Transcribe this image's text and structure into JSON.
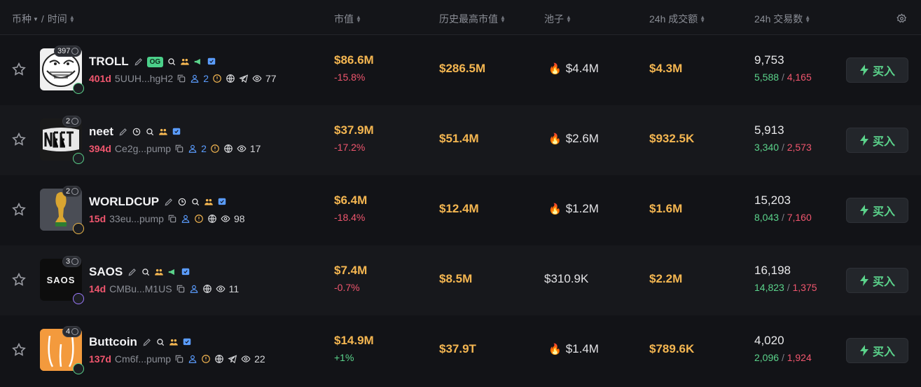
{
  "header": {
    "coin_label": "币种",
    "separator": "/",
    "time_label": "时间",
    "market_cap": "市值",
    "ath_market_cap": "历史最高市值",
    "pool": "池子",
    "volume_24h": "24h 成交额",
    "txns_24h": "24h 交易数"
  },
  "buy_label": "买入",
  "rows": [
    {
      "name": "TROLL",
      "og": "OG",
      "watchers": "397",
      "age": "401d",
      "address": "5UUH...hgH2",
      "holders": "2",
      "views": "77",
      "market_cap": "$86.6M",
      "change": "-15.8%",
      "ath": "$286.5M",
      "pool": "$4.4M",
      "pool_hot": true,
      "volume": "$4.3M",
      "txns": "9,753",
      "buys": "5,588",
      "slash": "/",
      "sells": "4,165"
    },
    {
      "name": "neet",
      "watchers": "2",
      "age": "394d",
      "address": "Ce2g...pump",
      "holders": "2",
      "views": "17",
      "market_cap": "$37.9M",
      "change": "-17.2%",
      "ath": "$51.4M",
      "pool": "$2.6M",
      "pool_hot": true,
      "volume": "$932.5K",
      "txns": "5,913",
      "buys": "3,340",
      "slash": "/",
      "sells": "2,573"
    },
    {
      "name": "WORLDCUP",
      "watchers": "2",
      "age": "15d",
      "address": "33eu...pump",
      "views": "98",
      "market_cap": "$6.4M",
      "change": "-18.4%",
      "ath": "$12.4M",
      "pool": "$1.2M",
      "pool_hot": true,
      "volume": "$1.6M",
      "txns": "15,203",
      "buys": "8,043",
      "slash": "/",
      "sells": "7,160"
    },
    {
      "name": "SAOS",
      "watchers": "3",
      "avatar_text": "SAOS",
      "age": "14d",
      "address": "CMBu...M1US",
      "views": "11",
      "market_cap": "$7.4M",
      "change": "-0.7%",
      "ath": "$8.5M",
      "pool": "$310.9K",
      "pool_hot": false,
      "volume": "$2.2M",
      "txns": "16,198",
      "buys": "14,823",
      "slash": "/",
      "sells": "1,375"
    },
    {
      "name": "Buttcoin",
      "watchers": "4",
      "age": "137d",
      "address": "Cm6f...pump",
      "views": "22",
      "market_cap": "$14.9M",
      "change": "+1%",
      "ath": "$37.9T",
      "pool": "$1.4M",
      "pool_hot": true,
      "volume": "$789.6K",
      "txns": "4,020",
      "buys": "2,096",
      "slash": "/",
      "sells": "1,924"
    }
  ]
}
